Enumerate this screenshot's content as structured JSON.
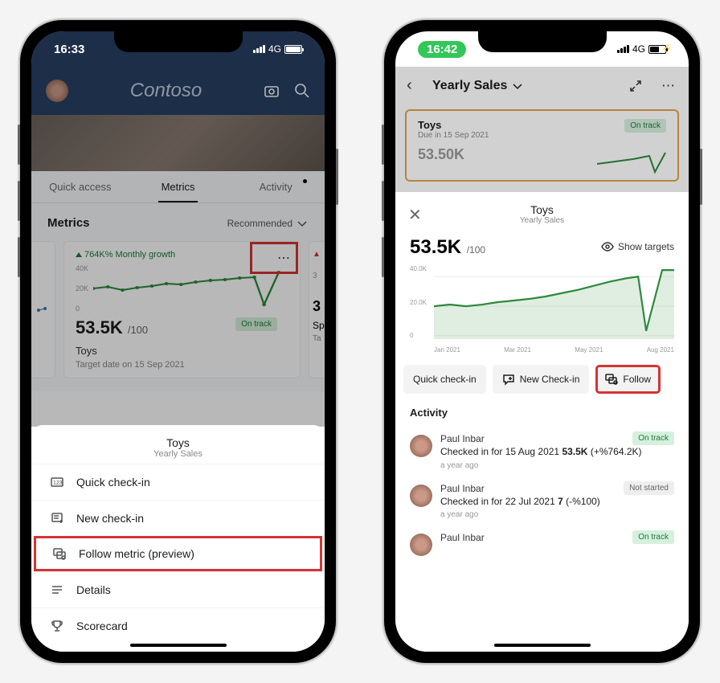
{
  "phone1": {
    "status": {
      "time": "16:33",
      "network": "4G"
    },
    "header": {
      "title": "Contoso"
    },
    "tabs": {
      "quick_access": "Quick access",
      "metrics": "Metrics",
      "activity": "Activity"
    },
    "metrics_header": {
      "label": "Metrics",
      "sort": "Recommended"
    },
    "card": {
      "growth_label": "764K% Monthly growth",
      "yticks": [
        "40K",
        "20K",
        "0"
      ],
      "value": "53.5K",
      "denom": "/100",
      "badge": "On track",
      "name": "Toys",
      "target": "Target date on 15 Sep 2021"
    },
    "card_right": {
      "value_peek": "3",
      "name_peek": "Sp",
      "target_peek": "Ta"
    },
    "sheet": {
      "title": "Toys",
      "subtitle": "Yearly Sales",
      "quick_checkin": "Quick check-in",
      "new_checkin": "New check-in",
      "follow": "Follow metric (preview)",
      "details": "Details",
      "scorecard": "Scorecard"
    }
  },
  "phone2": {
    "status": {
      "time": "16:42",
      "network": "4G"
    },
    "header_title": "Yearly Sales",
    "card_peek": {
      "name": "Toys",
      "due": "Due in 15 Sep 2021",
      "badge": "On track",
      "value_peek": "53.50K"
    },
    "sheet": {
      "title": "Toys",
      "subtitle": "Yearly Sales",
      "value": "53.5K",
      "denom": "/100",
      "show_targets": "Show targets",
      "yticks": [
        "40.0K",
        "20.0K",
        "0"
      ],
      "xticks": [
        "Jan 2021",
        "Mar 2021",
        "May 2021",
        "Aug 2021"
      ],
      "chip_quick": "Quick check-in",
      "chip_new": "New Check-in",
      "chip_follow": "Follow",
      "activity_label": "Activity",
      "items": [
        {
          "user": "Paul Inbar",
          "text": "Checked in for 15 Aug 2021 53.5K (+%764.2K)",
          "time": "a year ago",
          "badge": "On track",
          "badge_class": "ontrack"
        },
        {
          "user": "Paul Inbar",
          "text": "Checked in for 22 Jul 2021 7 (-%100)",
          "time": "a year ago",
          "badge": "Not started",
          "badge_class": "notstarted"
        },
        {
          "user": "Paul Inbar",
          "text": "",
          "time": "",
          "badge": "On track",
          "badge_class": "ontrack"
        }
      ]
    }
  },
  "chart_data": {
    "mini": {
      "type": "line",
      "title": "Toys monthly growth",
      "ylim": [
        0,
        45
      ],
      "yticks": [
        0,
        20,
        40
      ],
      "values": [
        22,
        24,
        20,
        23,
        24,
        27,
        26,
        29,
        30,
        31,
        33,
        34,
        8,
        40
      ]
    },
    "big": {
      "type": "area",
      "title": "Toys — Yearly Sales",
      "xlabel": "",
      "ylabel": "",
      "ylim": [
        0,
        50
      ],
      "yticks": [
        0,
        20,
        40
      ],
      "xticks": [
        "Jan 2021",
        "Mar 2021",
        "May 2021",
        "Aug 2021"
      ],
      "values": [
        22,
        24,
        22,
        23,
        25,
        26,
        27,
        28,
        30,
        33,
        35,
        38,
        40,
        6,
        48
      ]
    }
  }
}
